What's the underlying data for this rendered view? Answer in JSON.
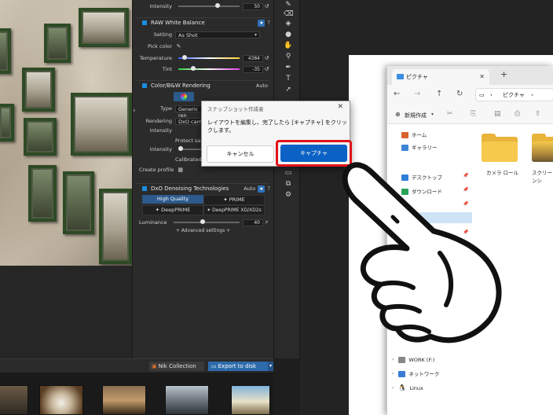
{
  "panel": {
    "intensity_top": {
      "label": "Intensity",
      "value": "50"
    },
    "raw_white_balance": {
      "title": "RAW White Balance",
      "setting_label": "Setting",
      "setting_value": "As Shot",
      "pick_color_label": "Pick color",
      "temperature_label": "Temperature",
      "temperature_value": "4384",
      "tint_label": "Tint",
      "tint_value": "-35"
    },
    "color_bw": {
      "title": "Color/B&W Rendering",
      "auto_label": "Auto",
      "type_label": "Type",
      "type_value": "Generic ren",
      "rendering_label": "Rendering",
      "rendering_value": "DxO came",
      "intensity_label": "Intensity",
      "protect_label": "Protect satu",
      "intensity2_label": "Intensity",
      "calibrated_label": "Calibrated",
      "create_profile_label": "Create profile"
    },
    "denoising": {
      "title": "DxO Denoising Technologies",
      "auto_label": "Auto",
      "high_quality": "High Quality",
      "prime": "PRIME",
      "deepprime": "DeepPRIME",
      "deepprime_xd": "DeepPRIME XD/XD2s",
      "luminance_label": "Luminance",
      "luminance_value": "40",
      "advanced": "+ Advanced settings +"
    }
  },
  "bottom_bar": {
    "nik_collection": "Nik Collection",
    "export": "Export to disk"
  },
  "dialog": {
    "title": "スナップショット作成者",
    "message": "レイアウトを編集し、完了したら [キャプチャ] をクリックします。",
    "cancel": "キャンセル",
    "capture": "キャプチャ"
  },
  "explorer": {
    "tab_title": "ピクチャ",
    "address": "ピクチャ",
    "new_button": "新規作成",
    "nav": {
      "home": "ホーム",
      "gallery": "ギャラリー",
      "desktop": "デスクトップ",
      "downloads": "ダウンロード",
      "work": "WORK (F:)",
      "network": "ネットワーク",
      "linux": "Linux"
    },
    "folders": [
      "カメラ ロール",
      "スクリーンシ"
    ]
  },
  "colors": {
    "accent_blue": "#0b62c4",
    "highlight_red": "#e0141b",
    "folder_yellow": "#f6c84c",
    "panel_bg": "#2b2b2b"
  }
}
